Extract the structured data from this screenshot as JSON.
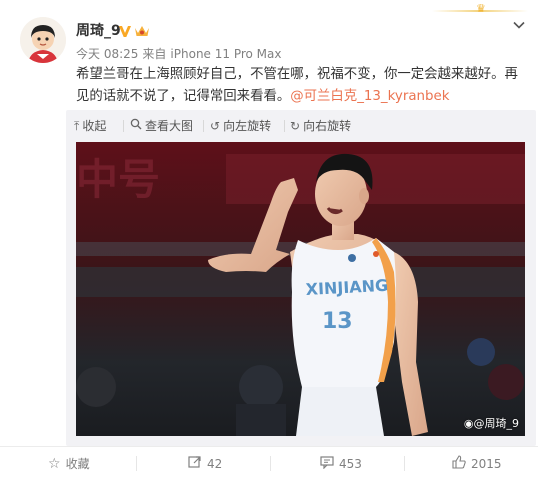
{
  "author": {
    "name": "周琦_9"
  },
  "post": {
    "time": "今天 08:25",
    "source_prefix": "来自",
    "source": "iPhone 11 Pro Max",
    "text": "希望兰哥在上海照顾好自己，不管在哪，祝福不变，你一定会越来越好。再见的话就不说了，记得常回来看看。",
    "mention": "@可兰白克_13_kyranbek"
  },
  "media_toolbar": {
    "collapse_label": "收起",
    "view_large_label": "查看大图",
    "rotate_left_label": "向左旋转",
    "rotate_right_label": "向右旋转"
  },
  "photo": {
    "watermark": "@周琦_9",
    "jersey_text": "XINJIANG",
    "jersey_number": "13"
  },
  "actions": {
    "favorite_label": "收藏",
    "repost_count": "42",
    "comment_count": "453",
    "like_count": "2015"
  },
  "colors": {
    "mention": "#eb7350",
    "jersey": "#f4f6fa",
    "jersey_trim": "#f2a04a",
    "court_bg": "#6b1820"
  },
  "icons": [
    "chevron-down-icon",
    "verified-icon",
    "svip-icon",
    "collapse-icon",
    "zoom-icon",
    "rotate-left-icon",
    "rotate-right-icon",
    "favorite-icon",
    "repost-icon",
    "comment-icon",
    "like-icon",
    "weibo-logo-icon"
  ]
}
